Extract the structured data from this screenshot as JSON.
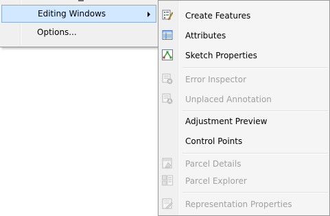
{
  "parent_menu": {
    "items": [
      {
        "label": "Editing Windows",
        "has_submenu": true,
        "highlighted": true
      },
      {
        "label": "Options...",
        "has_submenu": false,
        "highlighted": false
      }
    ]
  },
  "submenu": {
    "items": [
      {
        "label": "Create Features",
        "enabled": true,
        "icon": "create-features-icon"
      },
      {
        "label": "Attributes",
        "enabled": true,
        "icon": "attributes-icon"
      },
      {
        "label": "Sketch Properties",
        "enabled": true,
        "icon": "sketch-properties-icon"
      },
      {
        "label": "Error Inspector",
        "enabled": false,
        "icon": "error-inspector-icon"
      },
      {
        "label": "Unplaced Annotation",
        "enabled": false,
        "icon": "unplaced-annotation-icon"
      },
      {
        "label": "Adjustment Preview",
        "enabled": true,
        "icon": null
      },
      {
        "label": "Control Points",
        "enabled": true,
        "icon": null
      },
      {
        "label": "Parcel Details",
        "enabled": false,
        "icon": "parcel-details-icon"
      },
      {
        "label": "Parcel Explorer",
        "enabled": false,
        "icon": "parcel-explorer-icon"
      },
      {
        "label": "Representation Properties",
        "enabled": false,
        "icon": "representation-properties-icon"
      }
    ]
  },
  "colors": {
    "menu_background": "#f0f0f0",
    "highlight_fill": "#d1e8ff",
    "highlight_border": "#84acdd",
    "disabled_text": "#a0a0a0"
  }
}
